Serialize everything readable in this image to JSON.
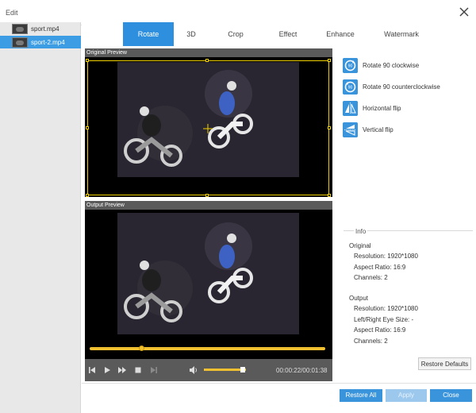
{
  "window": {
    "title": "Edit"
  },
  "sidebar": {
    "files": [
      {
        "name": "sport.mp4"
      },
      {
        "name": "sport-2.mp4"
      }
    ]
  },
  "tabs": [
    {
      "label": "Rotate"
    },
    {
      "label": "3D"
    },
    {
      "label": "Crop"
    },
    {
      "label": "Effect"
    },
    {
      "label": "Enhance"
    },
    {
      "label": "Watermark"
    }
  ],
  "preview": {
    "original_label": "Original Preview",
    "output_label": "Output Preview"
  },
  "player": {
    "time": "00:00:22/00:01:38",
    "seek_fraction": 0.22,
    "volume_fraction": 0.93
  },
  "rotate_actions": [
    {
      "label": "Rotate 90 clockwise",
      "icon": "rotate-clockwise-icon"
    },
    {
      "label": "Rotate 90 counterclockwise",
      "icon": "rotate-counterclockwise-icon"
    },
    {
      "label": "Horizontal flip",
      "icon": "horizontal-flip-icon"
    },
    {
      "label": "Vertical flip",
      "icon": "vertical-flip-icon"
    }
  ],
  "info": {
    "title": "Info",
    "original": {
      "heading": "Original",
      "resolution": "Resolution: 1920*1080",
      "aspect_ratio": "Aspect Ratio: 16:9",
      "channels": "Channels: 2"
    },
    "output": {
      "heading": "Output",
      "resolution": "Resolution: 1920*1080",
      "eye_size": "Left/Right Eye Size: -",
      "aspect_ratio": "Aspect Ratio: 16:9",
      "channels": "Channels: 2"
    }
  },
  "buttons": {
    "restore_defaults": "Restore Defaults",
    "restore_all": "Restore All",
    "apply": "Apply",
    "close": "Close"
  },
  "colors": {
    "accent": "#2e8fde",
    "progress": "#f0c030",
    "crop_frame": "#f0d000"
  }
}
